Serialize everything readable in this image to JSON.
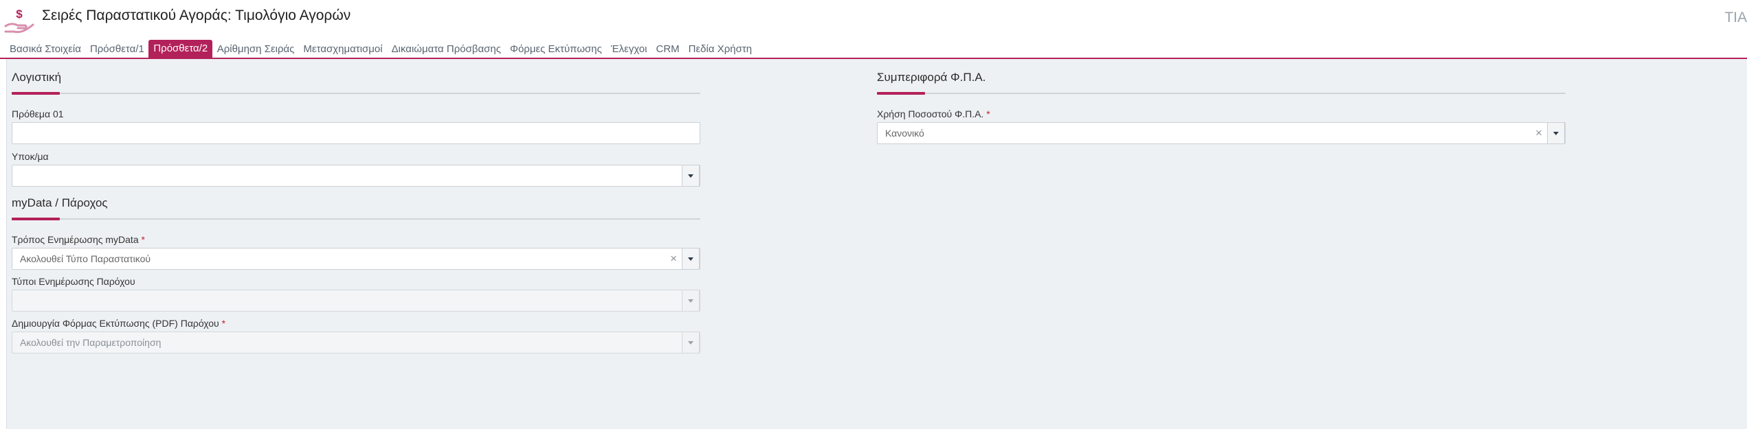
{
  "header": {
    "title": "Σειρές Παραστατικού Αγοράς: Τιμολόγιο Αγορών",
    "right_text": "ΤΙΑ",
    "icon": "hand-dollar-icon"
  },
  "tabs": [
    {
      "label": "Βασικά Στοιχεία",
      "active": false
    },
    {
      "label": "Πρόσθετα/1",
      "active": false
    },
    {
      "label": "Πρόσθετα/2",
      "active": true
    },
    {
      "label": "Αρίθμηση Σειράς",
      "active": false
    },
    {
      "label": "Μετασχηματισμοί",
      "active": false
    },
    {
      "label": "Δικαιώματα Πρόσβασης",
      "active": false
    },
    {
      "label": "Φόρμες Εκτύπωσης",
      "active": false
    },
    {
      "label": "Έλεγχοι",
      "active": false
    },
    {
      "label": "CRM",
      "active": false
    },
    {
      "label": "Πεδία Χρήστη",
      "active": false
    }
  ],
  "colors": {
    "accent": "#b3215a",
    "background": "#eef1f3",
    "required": "#c4202e"
  },
  "sections": {
    "accounting": {
      "title": "Λογιστική",
      "prefix_label": "Πρόθεμα 01",
      "prefix_value": "",
      "subaccount_label": "Υποκ/μα",
      "subaccount_value": ""
    },
    "mydata": {
      "title": "myData / Πάροχος",
      "update_mode_label": "Τρόπος Ενημέρωσης myData",
      "update_mode_value": "Ακολουθεί Τύπο Παραστατικού",
      "provider_types_label": "Τύποι Ενημέρωσης Παρόχου",
      "provider_types_value": "",
      "pdf_form_label": "Δημιουργία Φόρμας Εκτύπωσης (PDF) Παρόχου",
      "pdf_form_value": "Ακολουθεί την Παραμετροποίηση"
    },
    "vat": {
      "title": "Συμπεριφορά Φ.Π.Α.",
      "rate_label": "Χρήση Ποσοστού Φ.Π.Α.",
      "rate_value": "Κανονικό"
    }
  },
  "required_mark": "*",
  "clear_glyph": "×"
}
